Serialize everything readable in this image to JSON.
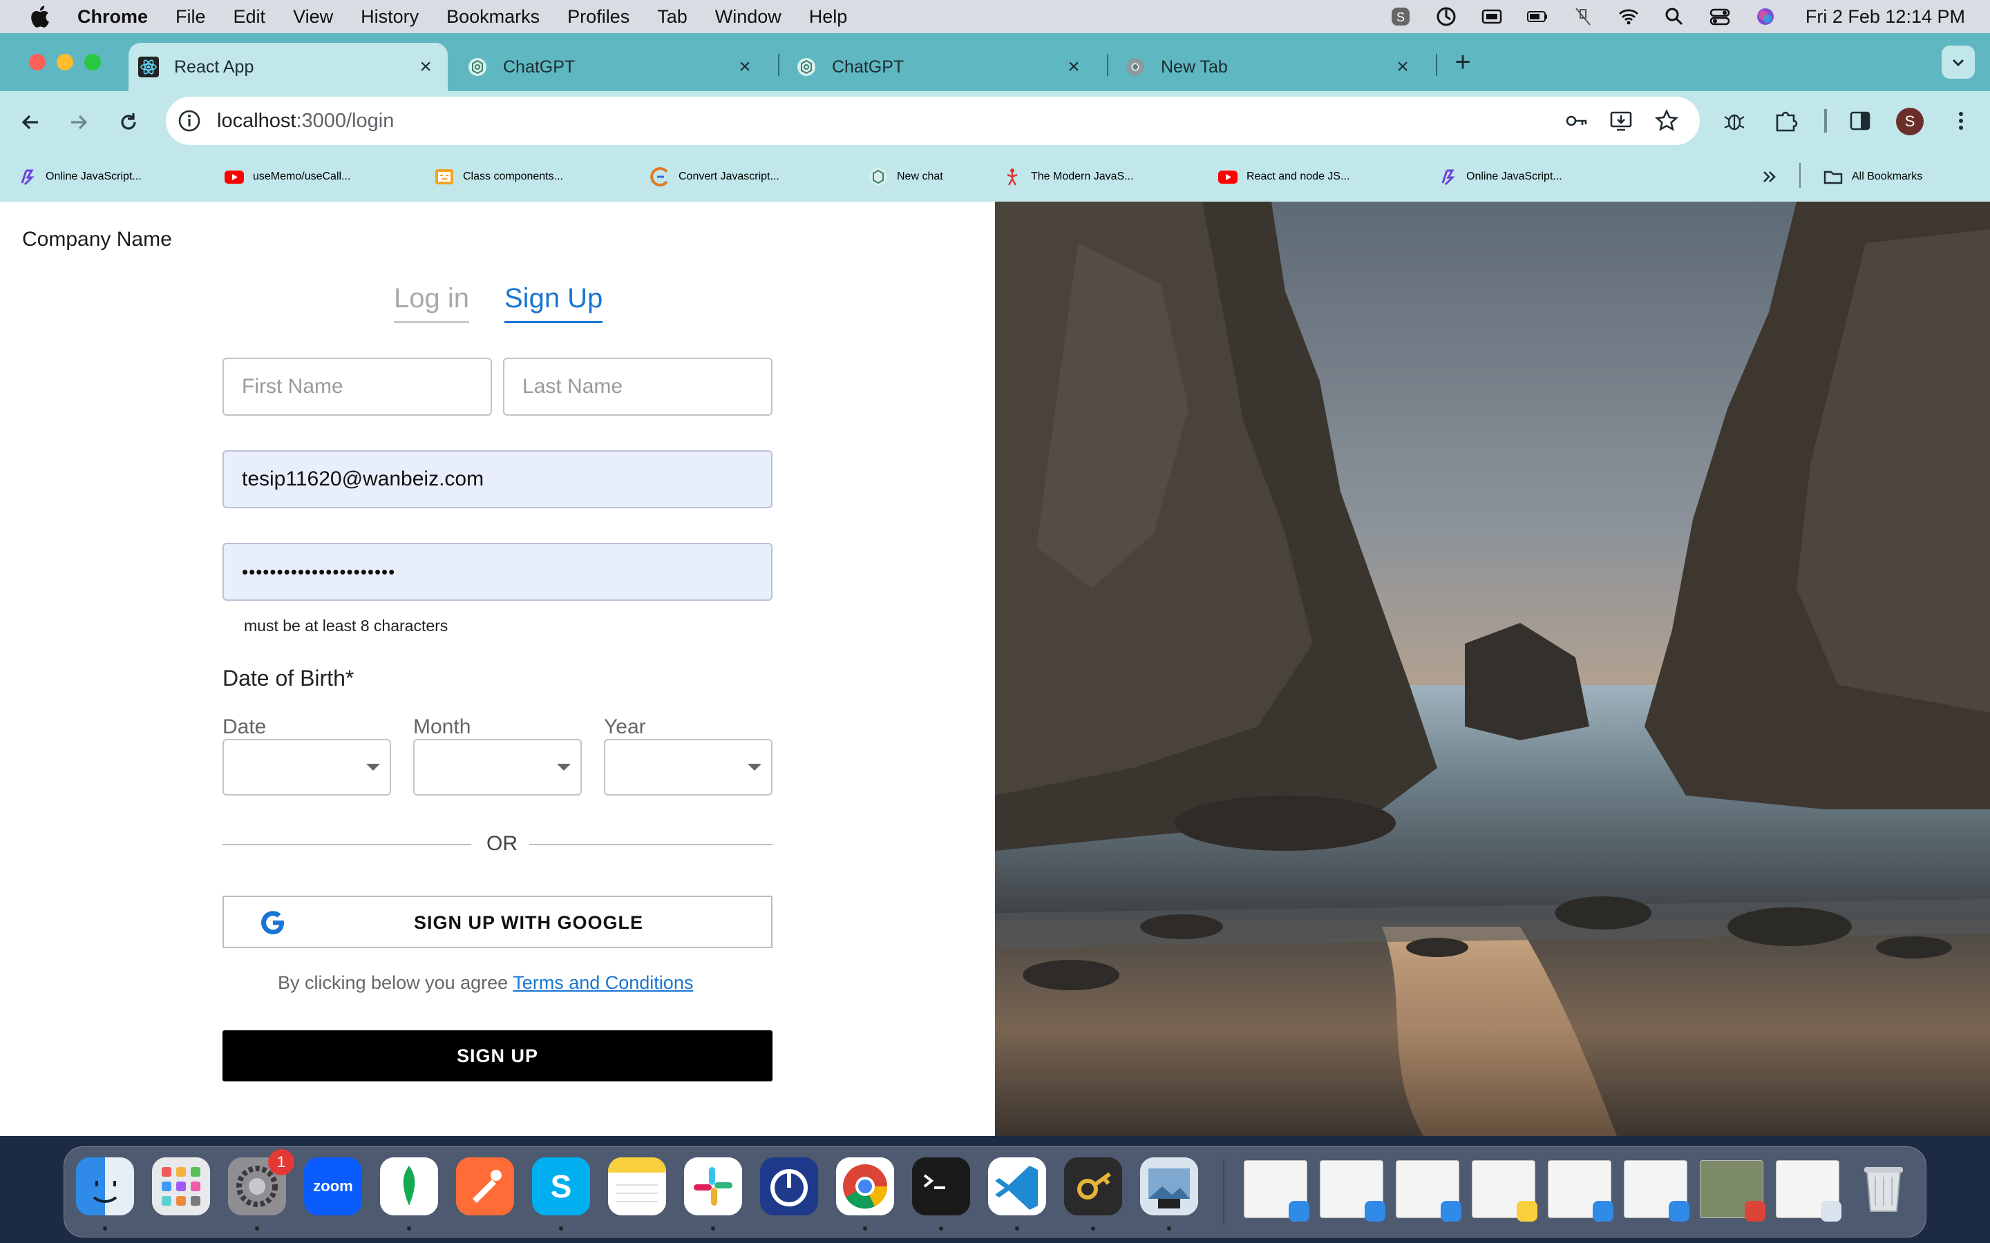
{
  "menubar": {
    "app_name": "Chrome",
    "items": [
      "File",
      "Edit",
      "View",
      "History",
      "Bookmarks",
      "Profiles",
      "Tab",
      "Window",
      "Help"
    ],
    "clock": "Fri 2 Feb  12:14 PM"
  },
  "browser": {
    "tabs": [
      {
        "title": "React App",
        "icon": "react-icon",
        "active": true
      },
      {
        "title": "ChatGPT",
        "icon": "chatgpt-icon",
        "active": false
      },
      {
        "title": "ChatGPT",
        "icon": "chatgpt-icon",
        "active": false
      },
      {
        "title": "New Tab",
        "icon": "chrome-icon",
        "active": false
      }
    ],
    "url_host": "localhost",
    "url_rest": ":3000/login",
    "profile_initial": "S",
    "bookmarks": [
      {
        "label": "Online JavaScript...",
        "icon": "programiz-icon"
      },
      {
        "label": "useMemo/useCall...",
        "icon": "youtube-icon"
      },
      {
        "label": "Class components...",
        "icon": "codesandbox-icon"
      },
      {
        "label": "Convert Javascript...",
        "icon": "converter-icon"
      },
      {
        "label": "New chat",
        "icon": "chatgpt-icon"
      },
      {
        "label": "The Modern JavaS...",
        "icon": "javascript-info-icon"
      },
      {
        "label": "React and node JS...",
        "icon": "youtube-icon"
      },
      {
        "label": "Online JavaScript...",
        "icon": "programiz-icon"
      }
    ],
    "all_bookmarks": "All Bookmarks"
  },
  "page": {
    "company_name": "Company Name",
    "tabs": {
      "login": "Log in",
      "signup": "Sign Up"
    },
    "first_name_placeholder": "First Name",
    "last_name_placeholder": "Last Name",
    "email_value": "tesip11620@wanbeiz.com",
    "password_mask": "••••••••••••••••••••••",
    "password_helper": "must be at least 8 characters",
    "dob_label": "Date of Birth*",
    "date_label": "Date",
    "month_label": "Month",
    "year_label": "Year",
    "or_text": "OR",
    "google_button": "SIGN UP WITH GOOGLE",
    "terms_prefix": "By clicking below you agree ",
    "terms_link": "Terms and Conditions",
    "signup_button": "SIGN UP"
  },
  "dock": {
    "apps": [
      "finder",
      "launchpad",
      "system-settings",
      "zoom",
      "mongodb-compass",
      "postman",
      "skype",
      "notes",
      "slack",
      "focus-timer",
      "chrome",
      "terminal",
      "vscode",
      "keychain",
      "preview"
    ],
    "settings_badge": "1",
    "zoom_label": "zoom"
  },
  "colors": {
    "accent": "#1976d2",
    "tabstrip": "#5fb7c1",
    "toolbar": "#c2e7ea",
    "autofill": "#e8eefc"
  }
}
